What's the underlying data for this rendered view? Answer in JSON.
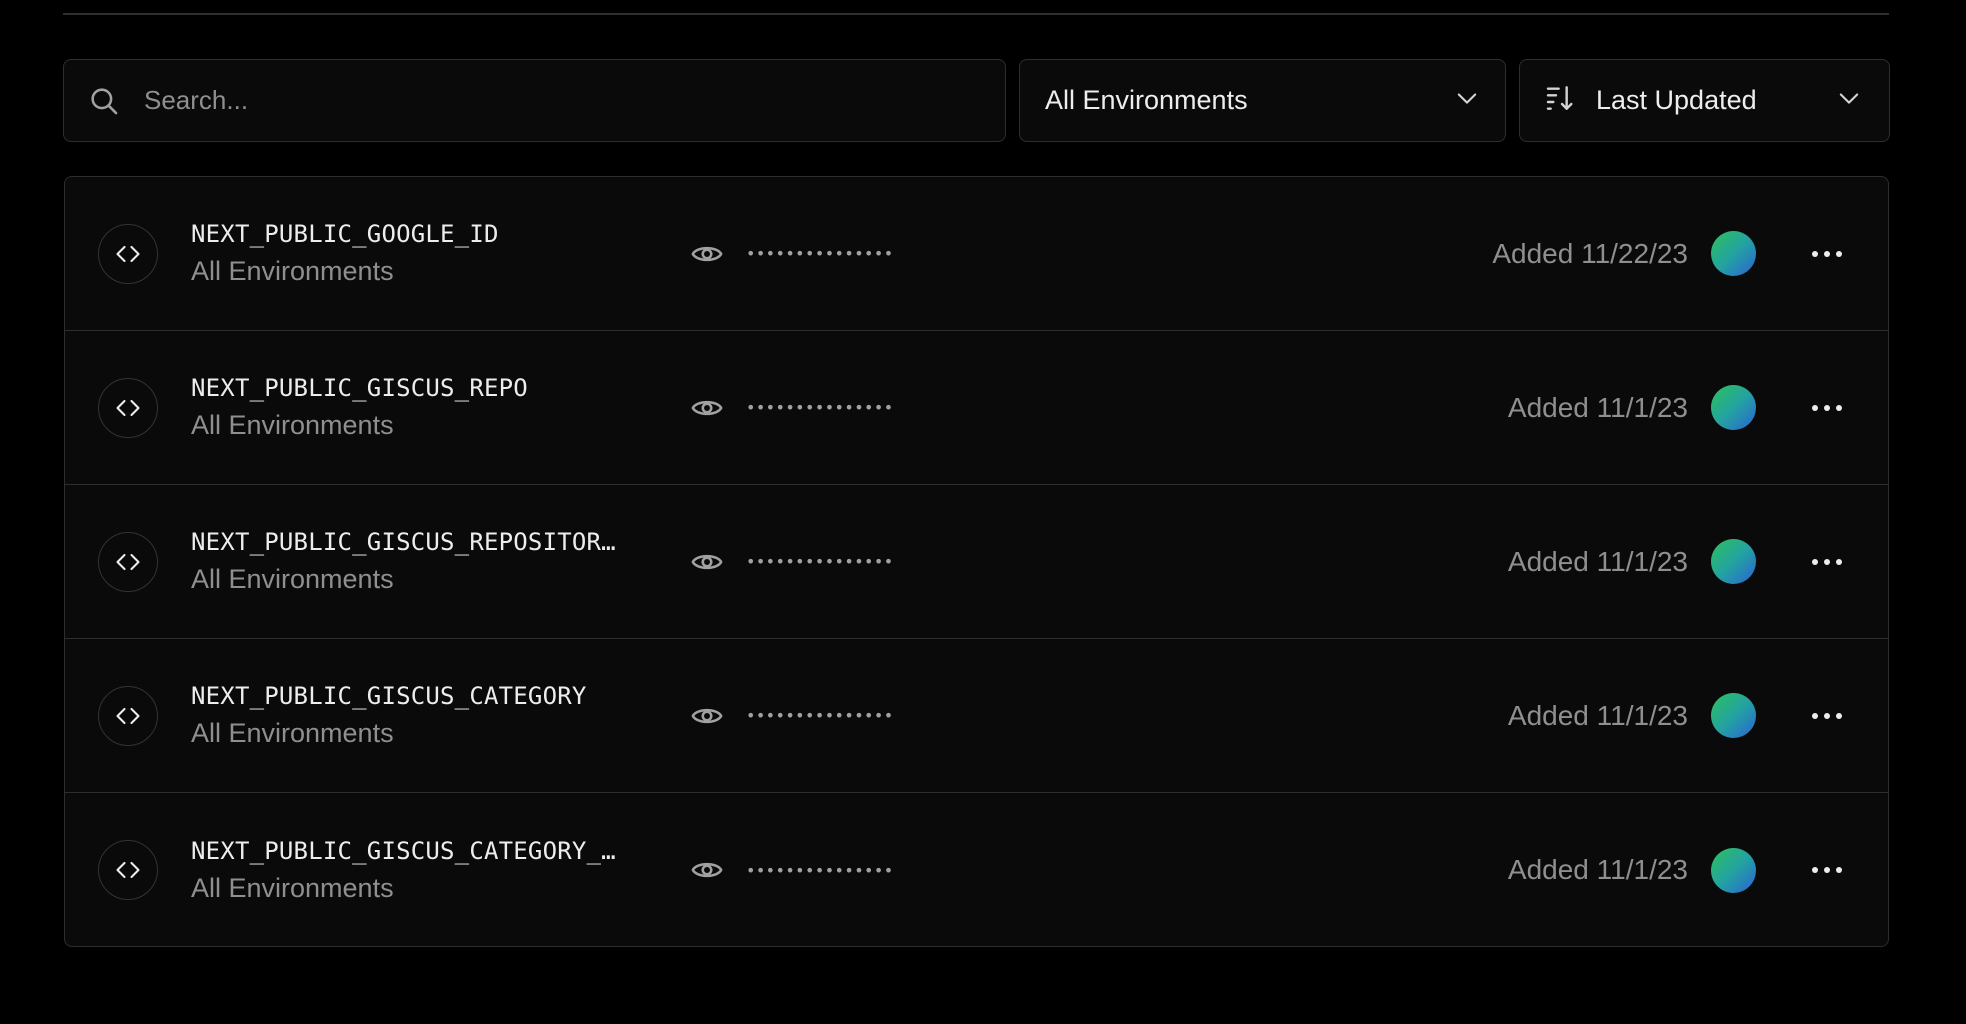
{
  "search": {
    "placeholder": "Search..."
  },
  "filters": {
    "environment_label": "All Environments",
    "sort_label": "Last Updated"
  },
  "icons": {
    "search": "search-icon",
    "chevron": "chevron-down-icon",
    "sort": "sort-descending-icon",
    "code": "code-icon",
    "eye": "eye-icon",
    "more": "more-horizontal-icon"
  },
  "colors": {
    "background": "#000000",
    "panel": "#0a0a0a",
    "border": "#2e2e2e",
    "text_primary": "#ededed",
    "text_muted": "#8f8f8f",
    "avatar_gradient_start": "#2ec15a",
    "avatar_gradient_end": "#2a62d6"
  },
  "env_vars": [
    {
      "name": "NEXT_PUBLIC_GOOGLE_ID",
      "environment": "All Environments",
      "masked_value": "•••••••••••••••",
      "added": "Added 11/22/23"
    },
    {
      "name": "NEXT_PUBLIC_GISCUS_REPO",
      "environment": "All Environments",
      "masked_value": "•••••••••••••••",
      "added": "Added 11/1/23"
    },
    {
      "name": "NEXT_PUBLIC_GISCUS_REPOSITOR…",
      "environment": "All Environments",
      "masked_value": "•••••••••••••••",
      "added": "Added 11/1/23"
    },
    {
      "name": "NEXT_PUBLIC_GISCUS_CATEGORY",
      "environment": "All Environments",
      "masked_value": "•••••••••••••••",
      "added": "Added 11/1/23"
    },
    {
      "name": "NEXT_PUBLIC_GISCUS_CATEGORY_…",
      "environment": "All Environments",
      "masked_value": "•••••••••••••••",
      "added": "Added 11/1/23"
    }
  ]
}
